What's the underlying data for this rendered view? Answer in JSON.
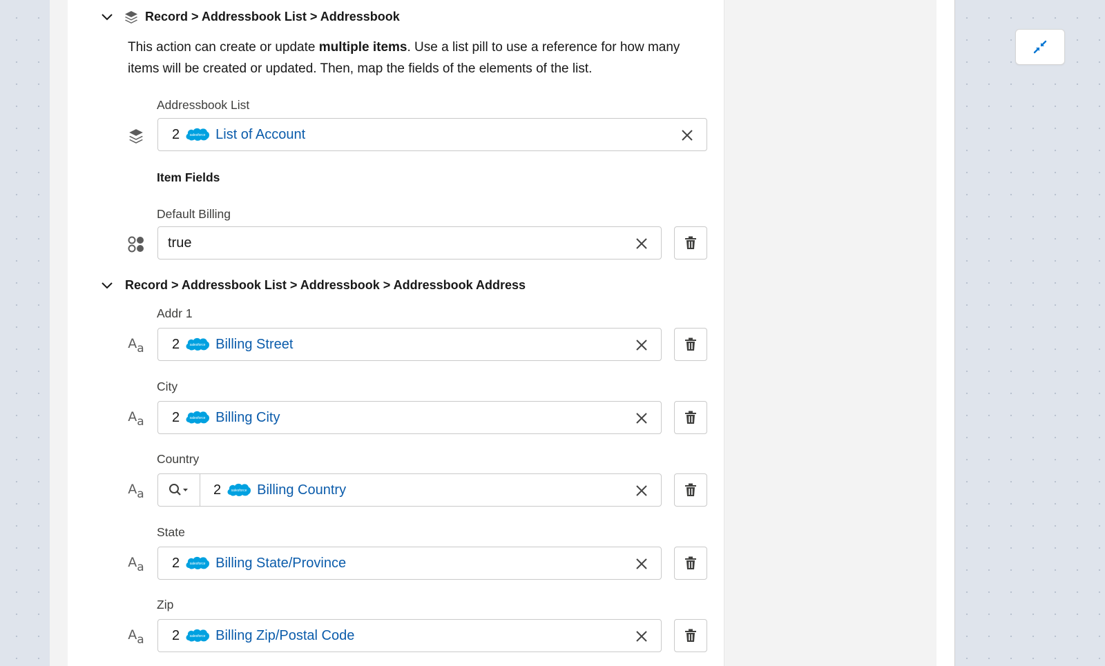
{
  "sections": [
    {
      "title": "Record > Addressbook List > Addressbook",
      "description_parts": [
        "This action can create or update ",
        "multiple items",
        ". Use a list pill to use a reference for how many items will be created or updated. Then, map the fields of the elements of the list."
      ],
      "list_field": {
        "label": "Addressbook List",
        "pill_count": "2",
        "pill_text": "List of Account",
        "icon": "layers-icon"
      },
      "item_fields_heading": "Item Fields",
      "fields": [
        {
          "label": "Default Billing",
          "value": "true",
          "icon": "boolean-icon"
        }
      ]
    },
    {
      "title": "Record > Addressbook List > Addressbook > Addressbook Address",
      "fields": [
        {
          "label": "Addr 1",
          "pill_count": "2",
          "pill_text": "Billing Street",
          "icon": "text-type-icon"
        },
        {
          "label": "City",
          "pill_count": "2",
          "pill_text": "Billing City",
          "icon": "text-type-icon"
        },
        {
          "label": "Country",
          "pill_count": "2",
          "pill_text": "Billing Country",
          "icon": "text-type-icon",
          "has_search": true
        },
        {
          "label": "State",
          "pill_count": "2",
          "pill_text": "Billing State/Province",
          "icon": "text-type-icon"
        },
        {
          "label": "Zip",
          "pill_count": "2",
          "pill_text": "Billing Zip/Postal Code",
          "icon": "text-type-icon"
        }
      ]
    }
  ],
  "text_type_glyph": {
    "upper": "A",
    "lower": "a"
  },
  "salesforce_logo_text": "salesforce",
  "colors": {
    "pill_text": "#0b5cab",
    "salesforce_cloud": "#00a1e0",
    "collapse_icon": "#0176d3"
  }
}
